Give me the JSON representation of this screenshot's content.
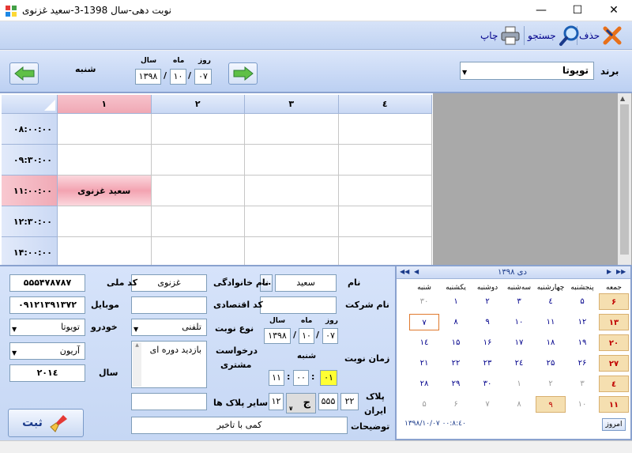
{
  "window": {
    "title": "نوبت دهی-سال 1398-3-سعید غزنوی"
  },
  "toolbar": {
    "delete": "حذف",
    "search": "جستجو",
    "print": "چاپ"
  },
  "header": {
    "brand_label": "برند",
    "brand_value": "تویوتا",
    "day_name": "شنبه",
    "date_labels": {
      "day": "روز",
      "month": "ماه",
      "year": "سال"
    },
    "date": {
      "day": "۰۷",
      "month": "۱۰",
      "year": "۱۳۹۸"
    },
    "sep": "/"
  },
  "grid": {
    "columns": [
      "۱",
      "۲",
      "۳",
      "٤"
    ],
    "rows": [
      "۰۸:۰۰:۰۰",
      "۰۹:۳۰:۰۰",
      "۱۱:۰۰:۰۰",
      "۱۲:۳۰:۰۰",
      "۱۴:۰۰:۰۰"
    ],
    "appointment": {
      "text": "سعید غزنوی",
      "row": 2,
      "col": 0
    }
  },
  "form": {
    "first_name_label": "نام",
    "first_name": "سعید",
    "last_name_label": "نام خانوادگی",
    "last_name": "غزنوی",
    "national_code_label": "کد ملی",
    "national_code": "۵۵۵۴۷۸۷۸۷",
    "company_label": "نام شرکت",
    "company": "",
    "economic_code_label": "کد اقتصادی",
    "economic_code": "",
    "mobile_label": "موبایل",
    "mobile": "۰۹۱۲۱۳۹۱۳۷۲",
    "type_label": "نوع نوبت",
    "type_value": "تلفنی",
    "car_label": "خودرو",
    "car_brand": "تویوتا",
    "car_model": "آریون",
    "date_labels": {
      "day": "روز",
      "month": "ماه",
      "year": "سال"
    },
    "date": {
      "day": "۰۷",
      "month": "۱۰",
      "year": "۱۳۹۸"
    },
    "request_label_1": "درخواست",
    "request_label_2": "مشتری",
    "request_text": "بازدید دوره ای",
    "year_label": "سال",
    "year_value": "۲۰۱٤",
    "time_label": "زمان نوبت",
    "time_day": "شنبه",
    "time": {
      "h": "۱۱",
      "m": "۰۰",
      "s": "۰۱"
    },
    "plate_label_1": "پلاک",
    "plate_label_2": "ایران",
    "plate": {
      "a": "۲۲",
      "b": "۵۵۵",
      "letter": "ج",
      "c": "۱۲"
    },
    "other_plates_label": "سایر پلاک ها",
    "other_plates": "",
    "notes_label": "توضیحات",
    "notes": "کمی با تاخیر",
    "submit": "ثبت",
    "browse": "..."
  },
  "calendar": {
    "month_title": "دی ۱۳۹۸",
    "weekdays": [
      "جمعه",
      "پنجشنبه",
      "چهارشنبه",
      "سه‌شنبه",
      "دوشنبه",
      "یکشنبه",
      "شنبه"
    ],
    "weeks": [
      [
        "۶",
        "۵",
        "٤",
        "۳",
        "۲",
        "۱",
        "۳۰"
      ],
      [
        "۱۳",
        "۱۲",
        "۱۱",
        "۱۰",
        "۹",
        "۸",
        "۷"
      ],
      [
        "۲۰",
        "۱۹",
        "۱۸",
        "۱۷",
        "۱۶",
        "۱۵",
        "۱٤"
      ],
      [
        "۲۷",
        "۲۶",
        "۲۵",
        "۲٤",
        "۲۳",
        "۲۲",
        "۲۱"
      ],
      [
        "٤",
        "۳",
        "۲",
        "۱",
        "۳۰",
        "۲۹",
        "۲۸"
      ],
      [
        "۱۱",
        "۱۰",
        "۹",
        "۸",
        "۷",
        "۶",
        "۵"
      ]
    ],
    "today_button": "امروز",
    "footer": "۱۳۹۸/۱۰/۰۷ ۰۰:۸:٤۰",
    "colors": {
      "holiday_bg": "#f5dfb0",
      "holiday_fg": "#c00000",
      "selected_border": "#e07a2e"
    }
  }
}
